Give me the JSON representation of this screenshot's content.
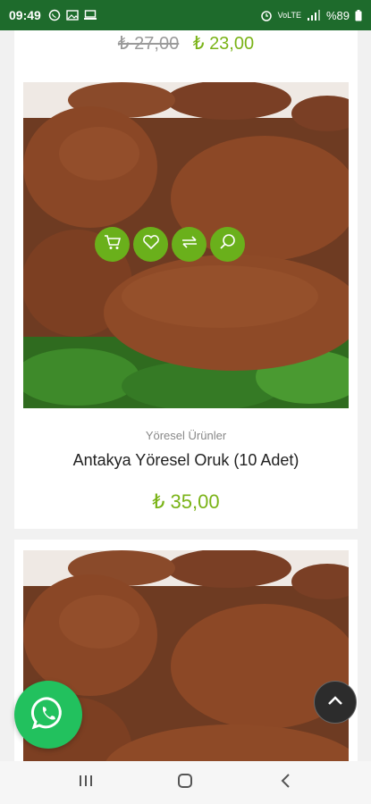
{
  "status_bar": {
    "time": "09:49",
    "network": "VoLTE",
    "battery": "%89"
  },
  "prev_product": {
    "old_price": "₺ 27,00",
    "new_price": "₺ 23,00"
  },
  "product": {
    "category": "Yöresel Ürünler",
    "title": "Antakya Yöresel Oruk (10 Adet)",
    "price": "₺ 35,00",
    "image_icon": "kibbeh-photo"
  },
  "actions": {
    "icons": [
      "cart-icon",
      "heart-icon",
      "compare-icon",
      "search-icon"
    ]
  },
  "floating": {
    "whatsapp_icon": "whatsapp-icon",
    "top_icon": "chevron-up-icon"
  },
  "colors": {
    "status_bar": "#1e6b2c",
    "accent": "#7ab317",
    "action_button": "#6ab01b",
    "whatsapp": "#22c15e"
  }
}
